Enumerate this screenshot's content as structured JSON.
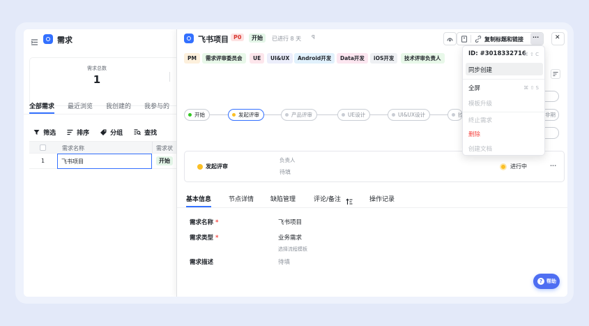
{
  "left": {
    "title": "需求",
    "summary": {
      "label": "需求总数",
      "value": "1"
    },
    "tabs": [
      "全部需求",
      "最近浏览",
      "我创建的",
      "我参与的"
    ],
    "toolbar": {
      "filter": "筛选",
      "sort": "排序",
      "group": "分组",
      "search": "查找"
    },
    "table": {
      "columns": [
        "需求名称",
        "需求状"
      ],
      "rows": [
        {
          "index": "1",
          "name": "飞书项目",
          "status": "开始"
        }
      ]
    }
  },
  "detail": {
    "title": "飞书项目",
    "priority": "P0",
    "status_tag": "开始",
    "elapsed": "已进行 8 天",
    "pin_glyph": "ꟼ",
    "copy_button": "复制标题和链接",
    "more_button": "···",
    "close_button": "✕",
    "role_tags": [
      "PM",
      "需求评审委员会",
      "UE",
      "UI&UX",
      "Android开发",
      "Data开发",
      "iOS开发",
      "技术评审负责人"
    ],
    "workflow_nodes": [
      "开始",
      "发起评审",
      "产品评审",
      "UE设计",
      "UI&UX设计",
      "技"
    ],
    "side_buttons": [
      "非期"
    ],
    "current_node": {
      "name": "发起评审",
      "assignee_label": "负责人",
      "assignee_value": "待填",
      "state": "进行中"
    },
    "tabs": [
      "基本信息",
      "节点详情",
      "缺陷管理",
      "评论/备注",
      "操作记录"
    ],
    "fields": [
      {
        "label": "需求名称",
        "value": "飞书项目",
        "required": "*"
      },
      {
        "label": "需求类型",
        "value": "业务需求",
        "required": "*",
        "hint": "选择流程模板"
      },
      {
        "label": "需求描述",
        "value": "待填"
      }
    ],
    "help_button": "帮助"
  },
  "menu": {
    "id_label": "ID: #3018332716",
    "id_shortcut": "⌘ ⇧ C",
    "items": [
      {
        "label": "同步创建",
        "state": "hover"
      },
      {
        "label": "全屏",
        "shortcut": "⌘ ⇧ S"
      },
      {
        "label": "模板升级",
        "state": "disabled"
      },
      {
        "label": "终止需求",
        "state": "disabled"
      },
      {
        "label": "删除",
        "state": "danger"
      },
      {
        "label": "创建文档",
        "state": "disabled"
      }
    ]
  },
  "colors": {
    "primary": "#3370ff",
    "danger": "#f54a45",
    "status_yellow": "#fbbf24",
    "green_tag": "#e4f6e8"
  }
}
